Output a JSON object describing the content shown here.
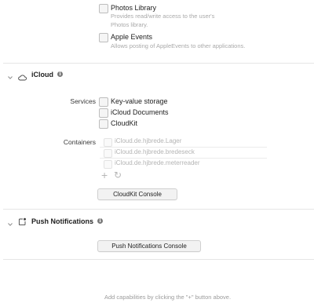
{
  "top_options": [
    {
      "label": "Photos Library",
      "description_lines": [
        "Provides read/write access to the user's",
        "Photos library."
      ]
    },
    {
      "label": "Apple Events",
      "description_lines": [
        "Allows posting of AppleEvents to other applications."
      ]
    }
  ],
  "icloud": {
    "title": "iCloud",
    "services_label": "Services",
    "services": [
      "Key-value storage",
      "iCloud Documents",
      "CloudKit"
    ],
    "containers_label": "Containers",
    "containers": [
      "iCloud.de.hjbrede.Lager",
      "iCloud.de.hjbrede.bredeseck",
      "iCloud.de.hjbrede.meterreader"
    ],
    "add_symbol": "+",
    "refresh_symbol": "↻",
    "console_button": "CloudKit Console"
  },
  "push": {
    "title": "Push Notifications",
    "console_button": "Push Notifications Console"
  },
  "footer_hint": "Add capabilities by clicking the \"+\" button above.",
  "info_glyph": "i"
}
